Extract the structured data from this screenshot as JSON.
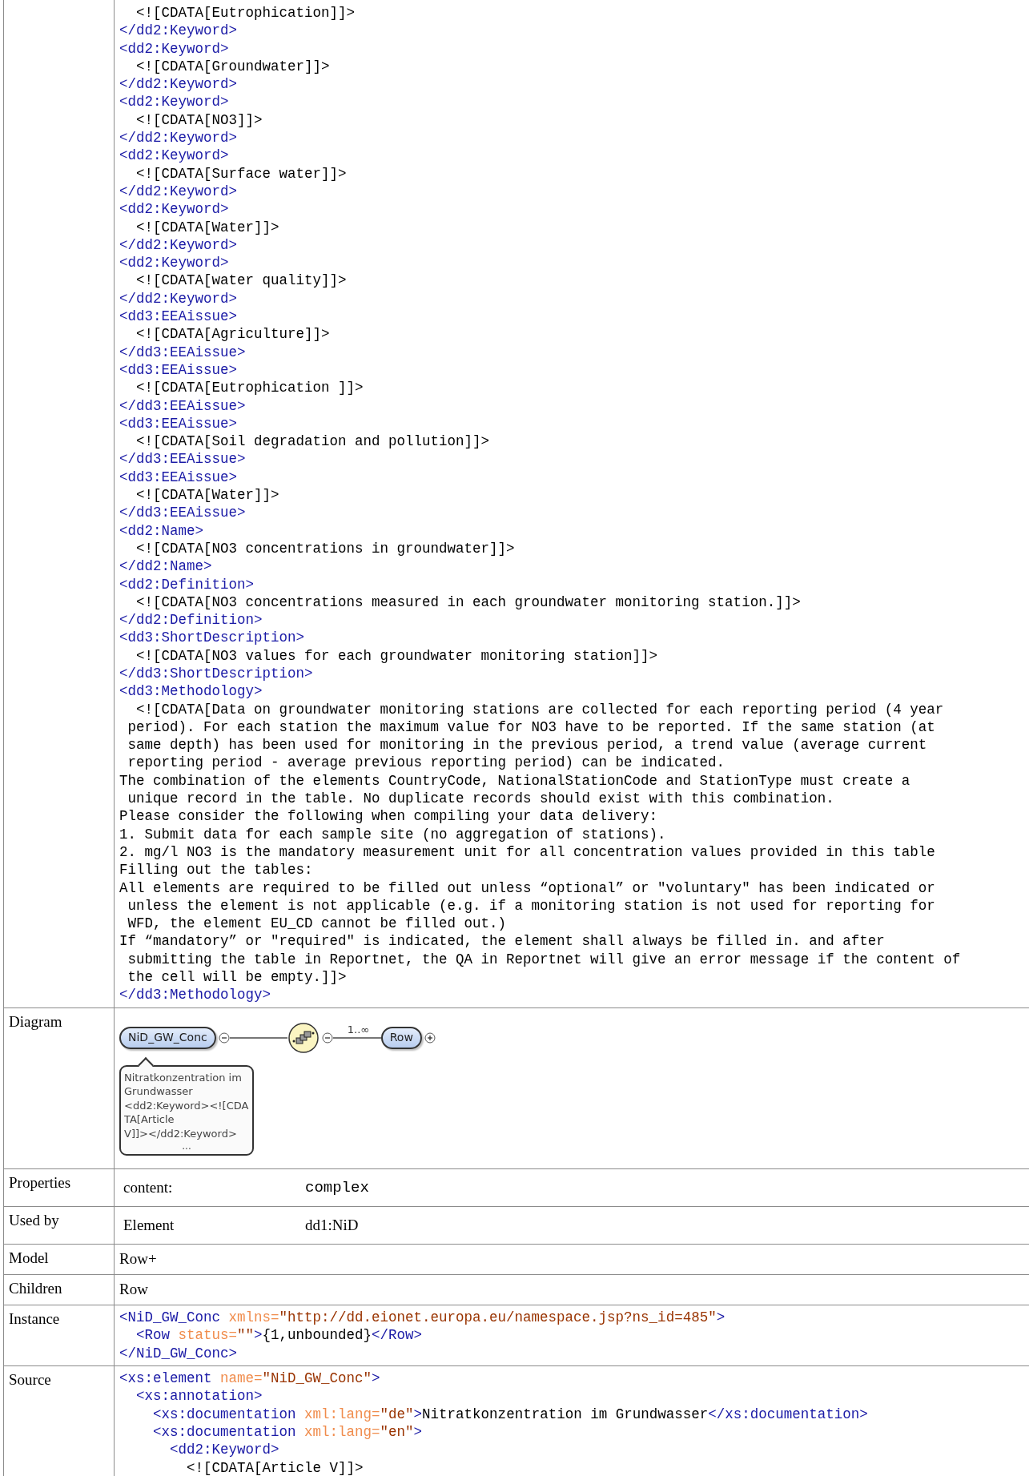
{
  "rows": [
    {
      "kind": "code",
      "lines": [
        [
          {
            "kind": "text",
            "s": "  <![CDATA[Eutrophication]]>"
          }
        ],
        [
          {
            "kind": "tag",
            "s": "</dd2:Keyword>"
          }
        ],
        [
          {
            "kind": "tag",
            "s": "<dd2:Keyword>"
          }
        ],
        [
          {
            "kind": "text",
            "s": "  <![CDATA[Groundwater]]>"
          }
        ],
        [
          {
            "kind": "tag",
            "s": "</dd2:Keyword>"
          }
        ],
        [
          {
            "kind": "tag",
            "s": "<dd2:Keyword>"
          }
        ],
        [
          {
            "kind": "text",
            "s": "  <![CDATA[NO3]]>"
          }
        ],
        [
          {
            "kind": "tag",
            "s": "</dd2:Keyword>"
          }
        ],
        [
          {
            "kind": "tag",
            "s": "<dd2:Keyword>"
          }
        ],
        [
          {
            "kind": "text",
            "s": "  <![CDATA[Surface water]]>"
          }
        ],
        [
          {
            "kind": "tag",
            "s": "</dd2:Keyword>"
          }
        ],
        [
          {
            "kind": "tag",
            "s": "<dd2:Keyword>"
          }
        ],
        [
          {
            "kind": "text",
            "s": "  <![CDATA[Water]]>"
          }
        ],
        [
          {
            "kind": "tag",
            "s": "</dd2:Keyword>"
          }
        ],
        [
          {
            "kind": "tag",
            "s": "<dd2:Keyword>"
          }
        ],
        [
          {
            "kind": "text",
            "s": "  <![CDATA[water quality]]>"
          }
        ],
        [
          {
            "kind": "tag",
            "s": "</dd2:Keyword>"
          }
        ],
        [
          {
            "kind": "tag",
            "s": "<dd3:EEAissue>"
          }
        ],
        [
          {
            "kind": "text",
            "s": "  <![CDATA[Agriculture]]>"
          }
        ],
        [
          {
            "kind": "tag",
            "s": "</dd3:EEAissue>"
          }
        ],
        [
          {
            "kind": "tag",
            "s": "<dd3:EEAissue>"
          }
        ],
        [
          {
            "kind": "text",
            "s": "  <![CDATA[Eutrophication ]]>"
          }
        ],
        [
          {
            "kind": "tag",
            "s": "</dd3:EEAissue>"
          }
        ],
        [
          {
            "kind": "tag",
            "s": "<dd3:EEAissue>"
          }
        ],
        [
          {
            "kind": "text",
            "s": "  <![CDATA[Soil degradation and pollution]]>"
          }
        ],
        [
          {
            "kind": "tag",
            "s": "</dd3:EEAissue>"
          }
        ],
        [
          {
            "kind": "tag",
            "s": "<dd3:EEAissue>"
          }
        ],
        [
          {
            "kind": "text",
            "s": "  <![CDATA[Water]]>"
          }
        ],
        [
          {
            "kind": "tag",
            "s": "</dd3:EEAissue>"
          }
        ],
        [
          {
            "kind": "tag",
            "s": "<dd2:Name>"
          }
        ],
        [
          {
            "kind": "text",
            "s": "  <![CDATA[NO3 concentrations in groundwater]]>"
          }
        ],
        [
          {
            "kind": "tag",
            "s": "</dd2:Name>"
          }
        ],
        [
          {
            "kind": "tag",
            "s": "<dd2:Definition>"
          }
        ],
        [
          {
            "kind": "text",
            "s": "  <![CDATA[NO3 concentrations measured in each groundwater monitoring station.]]>"
          }
        ],
        [
          {
            "kind": "tag",
            "s": "</dd2:Definition>"
          }
        ],
        [
          {
            "kind": "tag",
            "s": "<dd3:ShortDescription>"
          }
        ],
        [
          {
            "kind": "text",
            "s": "  <![CDATA[NO3 values for each groundwater monitoring station]]>"
          }
        ],
        [
          {
            "kind": "tag",
            "s": "</dd3:ShortDescription>"
          }
        ],
        [
          {
            "kind": "tag",
            "s": "<dd3:Methodology>"
          }
        ],
        [
          {
            "kind": "text",
            "s": "  <![CDATA[Data on groundwater monitoring stations are collected for each reporting period (4 year"
          }
        ],
        [
          {
            "kind": "text",
            "s": " period). For each station the maximum value for NO3 have to be reported. If the same station (at"
          }
        ],
        [
          {
            "kind": "text",
            "s": " same depth) has been used for monitoring in the previous period, a trend value (average current"
          }
        ],
        [
          {
            "kind": "text",
            "s": " reporting period - average previous reporting period) can be indicated."
          }
        ],
        [
          {
            "kind": "text",
            "s": "The combination of the elements CountryCode, NationalStationCode and StationType must create a"
          }
        ],
        [
          {
            "kind": "text",
            "s": " unique record in the table. No duplicate records should exist with this combination."
          }
        ],
        [
          {
            "kind": "text",
            "s": "Please consider the following when compiling your data delivery:"
          }
        ],
        [
          {
            "kind": "text",
            "s": "1. Submit data for each sample site (no aggregation of stations)."
          }
        ],
        [
          {
            "kind": "text",
            "s": "2. mg/l NO3 is the mandatory measurement unit for all concentration values provided in this table"
          }
        ],
        [
          {
            "kind": "text",
            "s": "Filling out the tables:"
          }
        ],
        [
          {
            "kind": "text",
            "s": "All elements are required to be filled out unless “optional” or \"voluntary\" has been indicated or"
          }
        ],
        [
          {
            "kind": "text",
            "s": " unless the element is not applicable (e.g. if a monitoring station is not used for reporting for"
          }
        ],
        [
          {
            "kind": "text",
            "s": " WFD, the element EU_CD cannot be filled out.)"
          }
        ],
        [
          {
            "kind": "text",
            "s": "If “mandatory” or \"required\" is indicated, the element shall always be filled in. and after"
          }
        ],
        [
          {
            "kind": "text",
            "s": " submitting the table in Reportnet, the QA in Reportnet will give an error message if the content of"
          }
        ],
        [
          {
            "kind": "text",
            "s": " the cell will be empty.]]>"
          }
        ],
        [
          {
            "kind": "tag",
            "s": "</dd3:Methodology>"
          }
        ]
      ]
    },
    {
      "kind": "diagram",
      "label": "Diagram",
      "root": "NiD_GW_Conc",
      "cardinality": "1..∞",
      "child": "Row",
      "note_lines": [
        "Nitratkonzentration im",
        "Grundwasser",
        "<dd2:Keyword><![CDA",
        "TA[Article",
        "V]]></dd2:Keyword>"
      ],
      "note_more": "..."
    },
    {
      "kind": "pairs",
      "label": "Properties",
      "pairs": [
        {
          "key": "content:",
          "value": "complex",
          "mono": true
        }
      ]
    },
    {
      "kind": "pairs",
      "label": "Used by",
      "pairs": [
        {
          "key": "Element",
          "value": "dd1:NiD",
          "mono": false
        }
      ]
    },
    {
      "kind": "plain",
      "label": "Model",
      "text": "Row+"
    },
    {
      "kind": "plain",
      "label": "Children",
      "text": "Row"
    },
    {
      "kind": "code",
      "label": "Instance",
      "lines": [
        [
          {
            "kind": "tag",
            "s": "<NiD_GW_Conc"
          },
          {
            "kind": "attr",
            "s": " xmlns="
          },
          {
            "kind": "value",
            "s": "\"http://dd.eionet.europa.eu/namespace.jsp?ns_id=485\""
          },
          {
            "kind": "tag",
            "s": ">"
          }
        ],
        [
          {
            "kind": "tag",
            "s": "  <Row"
          },
          {
            "kind": "attr",
            "s": " status="
          },
          {
            "kind": "value",
            "s": "\"\""
          },
          {
            "kind": "tag",
            "s": ">"
          },
          {
            "kind": "text",
            "s": "{1,unbounded}"
          },
          {
            "kind": "tag",
            "s": "</Row>"
          }
        ],
        [
          {
            "kind": "tag",
            "s": "</NiD_GW_Conc>"
          }
        ]
      ]
    },
    {
      "kind": "code",
      "label": "Source",
      "lines": [
        [
          {
            "kind": "tag",
            "s": "<xs:element"
          },
          {
            "kind": "attr",
            "s": " name="
          },
          {
            "kind": "value",
            "s": "\"NiD_GW_Conc\""
          },
          {
            "kind": "tag",
            "s": ">"
          }
        ],
        [
          {
            "kind": "tag",
            "s": "  <xs:annotation>"
          }
        ],
        [
          {
            "kind": "tag",
            "s": "    <xs:documentation"
          },
          {
            "kind": "attr",
            "s": " xml:lang="
          },
          {
            "kind": "value",
            "s": "\"de\""
          },
          {
            "kind": "tag",
            "s": ">"
          },
          {
            "kind": "text",
            "s": "Nitratkonzentration im Grundwasser"
          },
          {
            "kind": "tag",
            "s": "</xs:documentation>"
          }
        ],
        [
          {
            "kind": "tag",
            "s": "    <xs:documentation"
          },
          {
            "kind": "attr",
            "s": " xml:lang="
          },
          {
            "kind": "value",
            "s": "\"en\""
          },
          {
            "kind": "tag",
            "s": ">"
          }
        ],
        [
          {
            "kind": "tag",
            "s": "      <dd2:Keyword>"
          }
        ],
        [
          {
            "kind": "text",
            "s": "        <![CDATA[Article V]]>"
          }
        ]
      ]
    }
  ]
}
